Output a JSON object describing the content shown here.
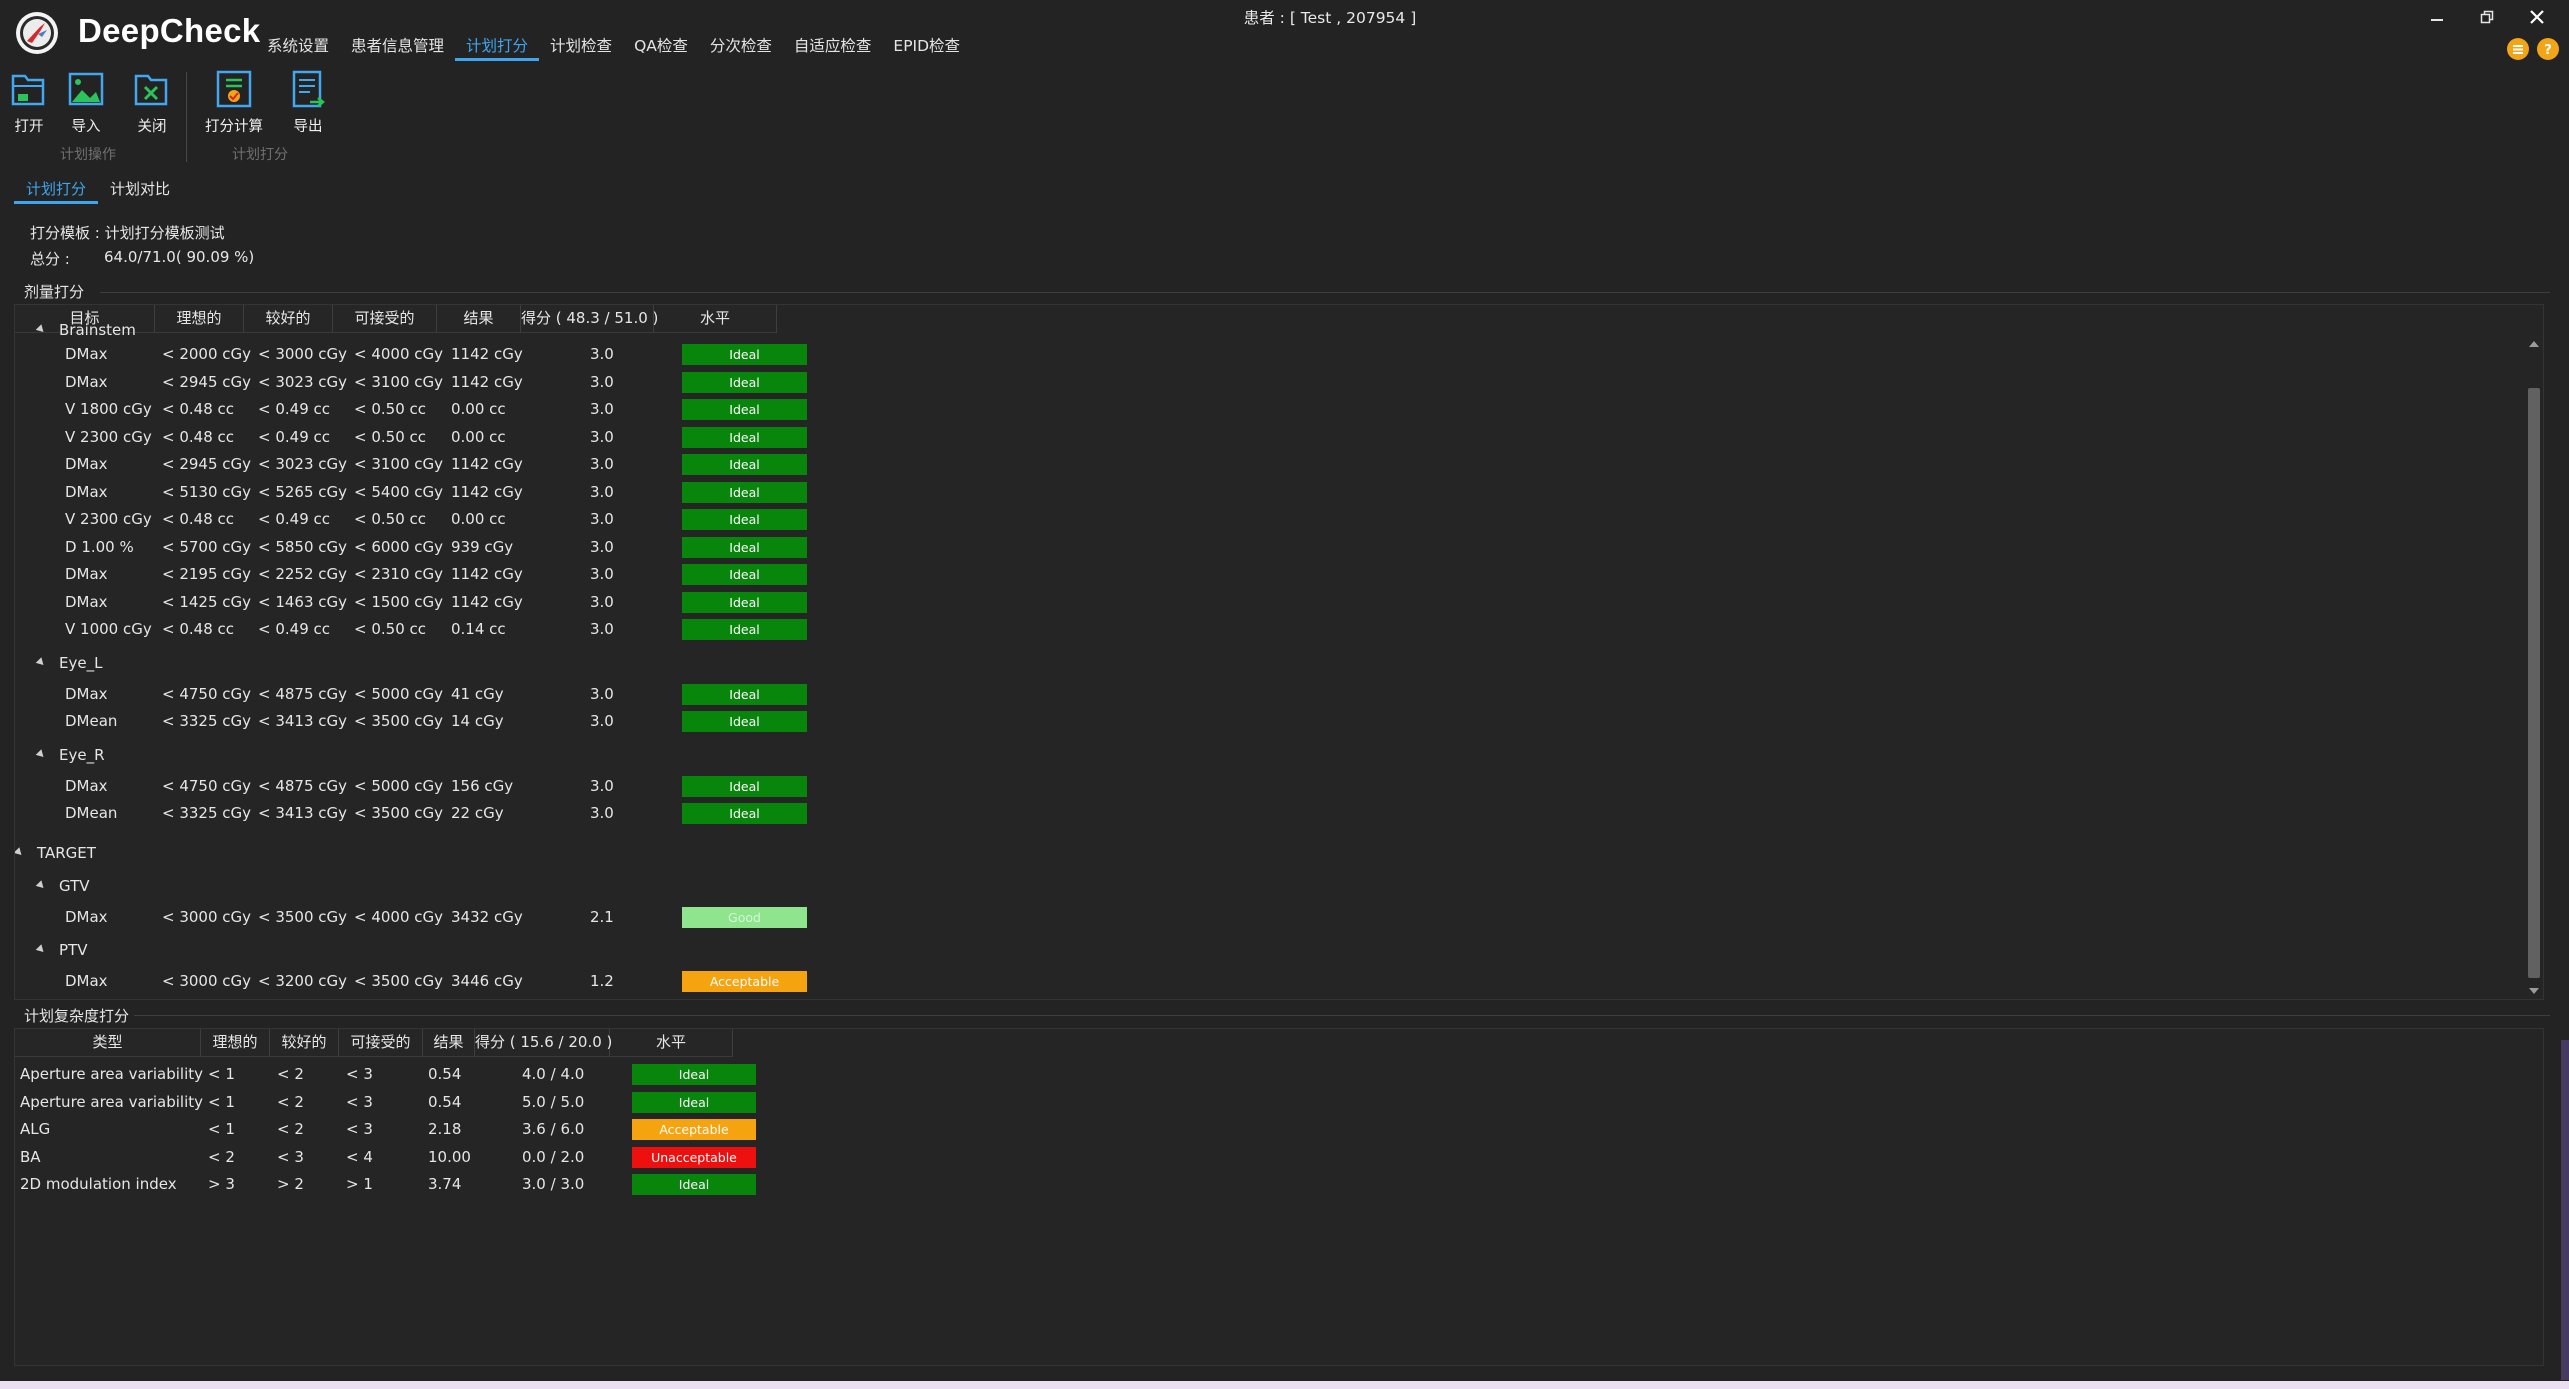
{
  "app": {
    "title": "DeepCheck",
    "patient": "患者 : [ Test , 207954 ]"
  },
  "menu": {
    "items": [
      "系统设置",
      "患者信息管理",
      "计划打分",
      "计划检查",
      "QA检查",
      "分次检查",
      "自适应检查",
      "EPID检查"
    ],
    "active_index": 2
  },
  "ribbon": {
    "plan_ops_label": "计划操作",
    "plan_score_label": "计划打分",
    "open": "打开",
    "import": "导入",
    "close": "关闭",
    "score_calc": "打分计算",
    "export": "导出"
  },
  "tabs": {
    "items": [
      "计划打分",
      "计划对比"
    ],
    "active_index": 0
  },
  "info": {
    "template": "打分模板 : 计划打分模板测试",
    "total_label": "总分 :",
    "total_value": "64.0/71.0( 90.09 %)"
  },
  "dose_section": {
    "title": "剂量打分",
    "headers": [
      "目标",
      "理想的",
      "较好的",
      "可接受的",
      "结果",
      "得分 ( 48.3 / 51.0 )",
      "水平"
    ],
    "groups": [
      {
        "name": "Brainstem",
        "level": 1,
        "rows": [
          {
            "target": "DMax",
            "ideal": "< 2000 cGy",
            "good": "< 3000 cGy",
            "acceptable": "< 4000 cGy",
            "result": "1142 cGy",
            "score": "3.0",
            "level": "Ideal"
          },
          {
            "target": "DMax",
            "ideal": "< 2945 cGy",
            "good": "< 3023 cGy",
            "acceptable": "< 3100 cGy",
            "result": "1142 cGy",
            "score": "3.0",
            "level": "Ideal"
          },
          {
            "target": "V 1800 cGy",
            "ideal": "< 0.48 cc",
            "good": "< 0.49 cc",
            "acceptable": "< 0.50 cc",
            "result": "0.00 cc",
            "score": "3.0",
            "level": "Ideal"
          },
          {
            "target": "V 2300 cGy",
            "ideal": "< 0.48 cc",
            "good": "< 0.49 cc",
            "acceptable": "< 0.50 cc",
            "result": "0.00 cc",
            "score": "3.0",
            "level": "Ideal"
          },
          {
            "target": "DMax",
            "ideal": "< 2945 cGy",
            "good": "< 3023 cGy",
            "acceptable": "< 3100 cGy",
            "result": "1142 cGy",
            "score": "3.0",
            "level": "Ideal"
          },
          {
            "target": "DMax",
            "ideal": "< 5130 cGy",
            "good": "< 5265 cGy",
            "acceptable": "< 5400 cGy",
            "result": "1142 cGy",
            "score": "3.0",
            "level": "Ideal"
          },
          {
            "target": "V 2300 cGy",
            "ideal": "< 0.48 cc",
            "good": "< 0.49 cc",
            "acceptable": "< 0.50 cc",
            "result": "0.00 cc",
            "score": "3.0",
            "level": "Ideal"
          },
          {
            "target": "D 1.00 %",
            "ideal": "< 5700 cGy",
            "good": "< 5850 cGy",
            "acceptable": "< 6000 cGy",
            "result": "939 cGy",
            "score": "3.0",
            "level": "Ideal"
          },
          {
            "target": "DMax",
            "ideal": "< 2195 cGy",
            "good": "< 2252 cGy",
            "acceptable": "< 2310 cGy",
            "result": "1142 cGy",
            "score": "3.0",
            "level": "Ideal"
          },
          {
            "target": "DMax",
            "ideal": "< 1425 cGy",
            "good": "< 1463 cGy",
            "acceptable": "< 1500 cGy",
            "result": "1142 cGy",
            "score": "3.0",
            "level": "Ideal"
          },
          {
            "target": "V 1000 cGy",
            "ideal": "< 0.48 cc",
            "good": "< 0.49 cc",
            "acceptable": "< 0.50 cc",
            "result": "0.14 cc",
            "score": "3.0",
            "level": "Ideal"
          }
        ]
      },
      {
        "name": "Eye_L",
        "level": 1,
        "rows": [
          {
            "target": "DMax",
            "ideal": "< 4750 cGy",
            "good": "< 4875 cGy",
            "acceptable": "< 5000 cGy",
            "result": "41 cGy",
            "score": "3.0",
            "level": "Ideal"
          },
          {
            "target": "DMean",
            "ideal": "< 3325 cGy",
            "good": "< 3413 cGy",
            "acceptable": "< 3500 cGy",
            "result": "14 cGy",
            "score": "3.0",
            "level": "Ideal"
          }
        ]
      },
      {
        "name": "Eye_R",
        "level": 1,
        "rows": [
          {
            "target": "DMax",
            "ideal": "< 4750 cGy",
            "good": "< 4875 cGy",
            "acceptable": "< 5000 cGy",
            "result": "156 cGy",
            "score": "3.0",
            "level": "Ideal"
          },
          {
            "target": "DMean",
            "ideal": "< 3325 cGy",
            "good": "< 3413 cGy",
            "acceptable": "< 3500 cGy",
            "result": "22 cGy",
            "score": "3.0",
            "level": "Ideal"
          }
        ]
      },
      {
        "name": "TARGET",
        "level": 0,
        "rows": []
      },
      {
        "name": "GTV",
        "level": 1,
        "rows": [
          {
            "target": "DMax",
            "ideal": "< 3000 cGy",
            "good": "< 3500 cGy",
            "acceptable": "< 4000 cGy",
            "result": "3432 cGy",
            "score": "2.1",
            "level": "Good"
          }
        ]
      },
      {
        "name": "PTV",
        "level": 1,
        "rows": [
          {
            "target": "DMax",
            "ideal": "< 3000 cGy",
            "good": "< 3200 cGy",
            "acceptable": "< 3500 cGy",
            "result": "3446 cGy",
            "score": "1.2",
            "level": "Acceptable"
          }
        ]
      }
    ]
  },
  "complexity_section": {
    "title": "计划复杂度打分",
    "headers": [
      "类型",
      "理想的",
      "较好的",
      "可接受的",
      "结果",
      "得分 ( 15.6 / 20.0 )",
      "水平"
    ],
    "rows": [
      {
        "type": "Aperture area variability",
        "ideal": "< 1",
        "good": "< 2",
        "acceptable": "< 3",
        "result": "0.54",
        "score": "4.0 / 4.0",
        "level": "Ideal"
      },
      {
        "type": "Aperture area variability",
        "ideal": "< 1",
        "good": "< 2",
        "acceptable": "< 3",
        "result": "0.54",
        "score": "5.0 / 5.0",
        "level": "Ideal"
      },
      {
        "type": "ALG",
        "ideal": "< 1",
        "good": "< 2",
        "acceptable": "< 3",
        "result": "2.18",
        "score": "3.6 / 6.0",
        "level": "Acceptable"
      },
      {
        "type": "BA",
        "ideal": "< 2",
        "good": "< 3",
        "acceptable": "< 4",
        "result": "10.00",
        "score": "0.0 / 2.0",
        "level": "Unacceptable"
      },
      {
        "type": "2D modulation index",
        "ideal": "> 3",
        "good": "> 2",
        "acceptable": "> 1",
        "result": "3.74",
        "score": "3.0 / 3.0",
        "level": "Ideal"
      }
    ]
  },
  "colors": {
    "accent": "#3ea6ef",
    "ideal": "#07860b",
    "good": "#8fe58d",
    "acceptable": "#f6a310",
    "unacceptable": "#ee0f0f",
    "background": "#232323"
  }
}
